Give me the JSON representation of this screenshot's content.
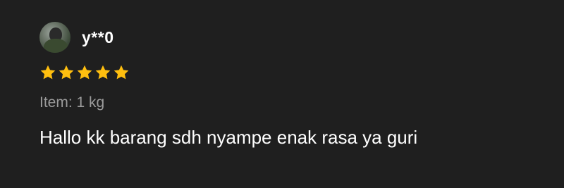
{
  "review": {
    "username": "y**0",
    "rating": 5,
    "max_rating": 5,
    "star_color": "#ffbf0f",
    "item_variant": "Item: 1 kg",
    "text": "Hallo kk barang sdh nyampe enak rasa ya guri"
  },
  "icons": {
    "star": "star-icon",
    "avatar": "avatar"
  }
}
